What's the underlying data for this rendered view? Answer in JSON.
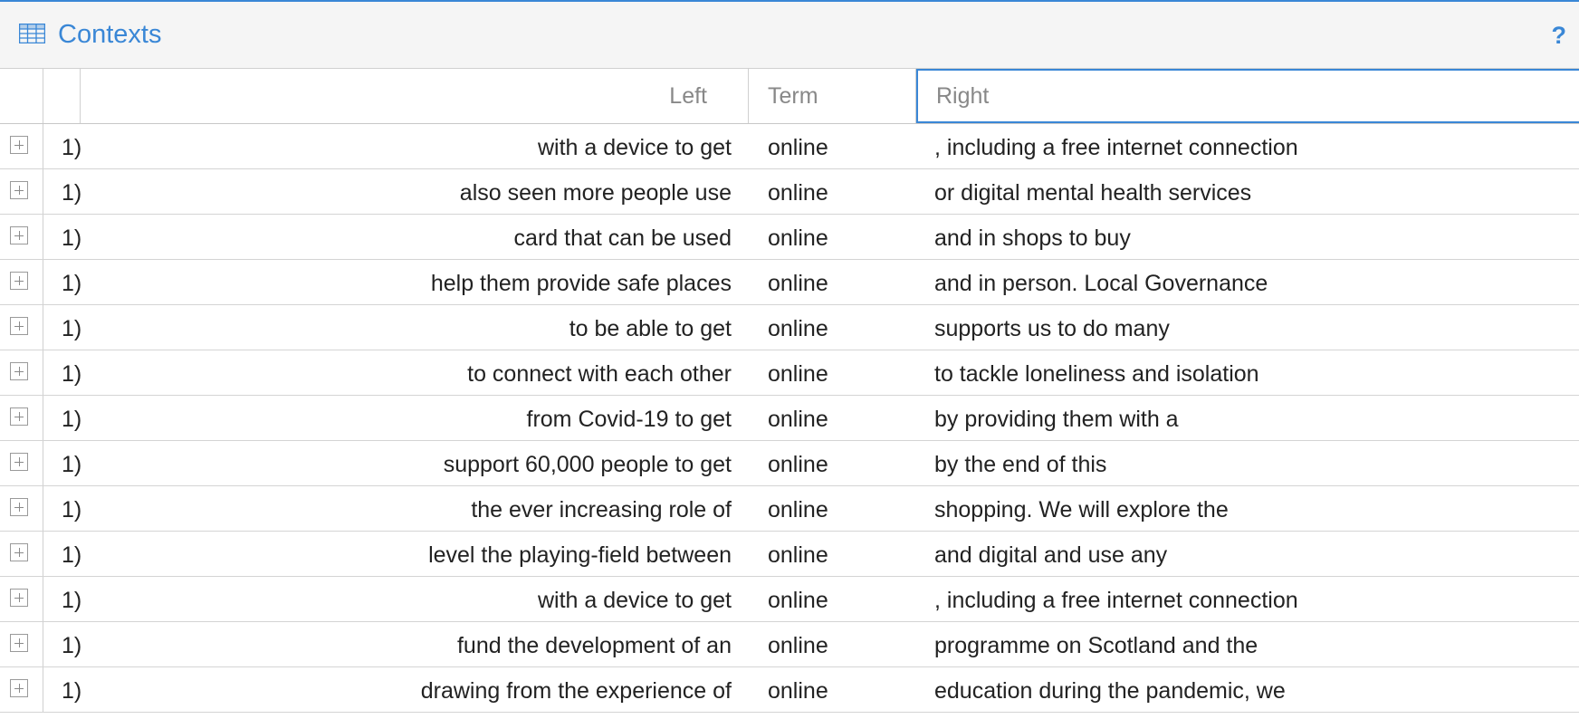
{
  "header": {
    "title": "Contexts",
    "help_label": "?",
    "icon": "table-grid-icon",
    "help_icon": "question-mark-icon",
    "accent_color": "#3a87d6"
  },
  "columns": {
    "left": "Left",
    "term": "Term",
    "right": "Right"
  },
  "row_expand_icon": "expand-plus-icon",
  "rows": [
    {
      "num": "1)",
      "left": "with a device to get",
      "term": "online",
      "right": ", including a free internet connection"
    },
    {
      "num": "1)",
      "left": "also seen more people use",
      "term": "online",
      "right": "or digital mental health services"
    },
    {
      "num": "1)",
      "left": "card that can be used",
      "term": "online",
      "right": "and in shops to buy"
    },
    {
      "num": "1)",
      "left": "help them provide safe places",
      "term": "online",
      "right": "and in person. Local Governance"
    },
    {
      "num": "1)",
      "left": "to be able to get",
      "term": "online",
      "right": "supports us to do many"
    },
    {
      "num": "1)",
      "left": "to connect with each other",
      "term": "online",
      "right": "to tackle loneliness and isolation"
    },
    {
      "num": "1)",
      "left": "from Covid-19 to get",
      "term": "online",
      "right": "by providing them with a"
    },
    {
      "num": "1)",
      "left": "support 60,000 people to get",
      "term": "online",
      "right": "by the end of this"
    },
    {
      "num": "1)",
      "left": "the ever increasing role of",
      "term": "online",
      "right": "shopping. We will explore the"
    },
    {
      "num": "1)",
      "left": "level the playing-field between",
      "term": "online",
      "right": "and digital and use any"
    },
    {
      "num": "1)",
      "left": "with a device to get",
      "term": "online",
      "right": ", including a free internet connection"
    },
    {
      "num": "1)",
      "left": "fund the development of an",
      "term": "online",
      "right": "programme on Scotland and the"
    },
    {
      "num": "1)",
      "left": "drawing from the experience of",
      "term": "online",
      "right": "education during the pandemic, we"
    }
  ]
}
